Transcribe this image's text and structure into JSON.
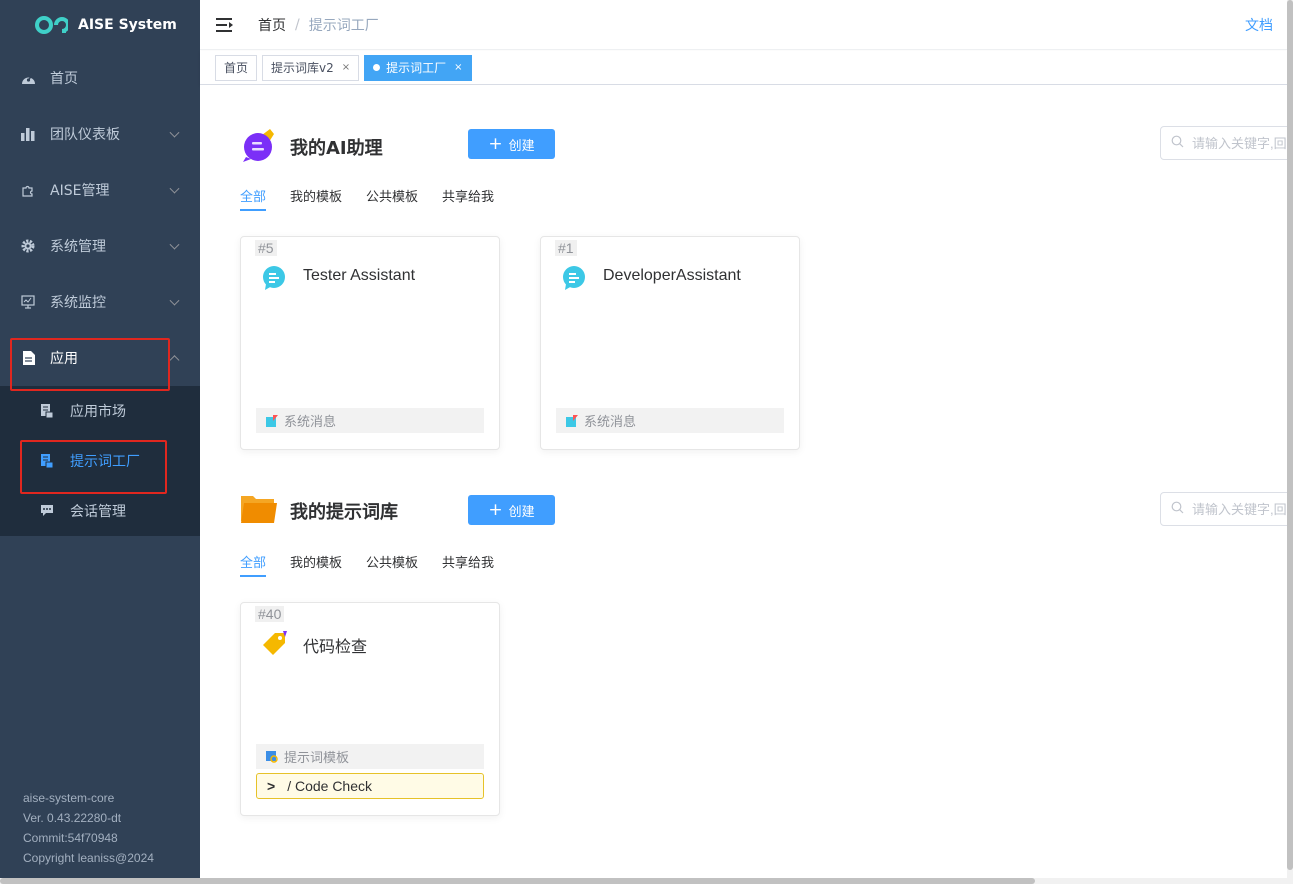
{
  "app": {
    "name": "AISE System"
  },
  "sidebar": {
    "items": [
      {
        "label": "首页",
        "icon": "dashboard-icon"
      },
      {
        "label": "团队仪表板",
        "icon": "bar-chart-icon"
      },
      {
        "label": "AISE管理",
        "icon": "puzzle-icon"
      },
      {
        "label": "系统管理",
        "icon": "gear-icon"
      },
      {
        "label": "系统监控",
        "icon": "monitor-icon"
      },
      {
        "label": "应用",
        "icon": "document-icon"
      }
    ],
    "sub_items": [
      {
        "label": "应用市场",
        "icon": "app-market-icon"
      },
      {
        "label": "提示词工厂",
        "icon": "prompt-factory-icon"
      },
      {
        "label": "会话管理",
        "icon": "chat-icon"
      }
    ],
    "version": {
      "module": "aise-system-core",
      "ver": "Ver. 0.43.22280-dt",
      "commit": "Commit:54f70948",
      "copyright": "Copyright leaniss@2024"
    }
  },
  "header": {
    "breadcrumb_home": "首页",
    "breadcrumb_sep": "/",
    "breadcrumb_current": "提示词工厂",
    "doc_link": "文档"
  },
  "tags": [
    {
      "label": "首页"
    },
    {
      "label": "提示词库v2",
      "close": "×"
    },
    {
      "label": "提示词工厂",
      "close": "×"
    }
  ],
  "assistant_section": {
    "title": "我的AI助理",
    "create_label": "创建",
    "search_placeholder": "请输入关键字,回车搜索",
    "tabs": [
      "全部",
      "我的模板",
      "公共模板",
      "共享给我"
    ],
    "cards": [
      {
        "id": "#5",
        "title": "Tester Assistant",
        "footer": "系统消息"
      },
      {
        "id": "#1",
        "title": "DeveloperAssistant",
        "footer": "系统消息"
      }
    ]
  },
  "prompt_section": {
    "title": "我的提示词库",
    "create_label": "创建",
    "search_placeholder": "请输入关键字,回车搜索",
    "tabs": [
      "全部",
      "我的模板",
      "公共模板",
      "共享给我"
    ],
    "cards": [
      {
        "id": "#40",
        "title": "代码检查",
        "footer": "提示词模板",
        "command_prefix": ">",
        "command": "/ Code Check"
      }
    ]
  },
  "colors": {
    "sidebar_bg": "#304156",
    "submenu_bg": "#1f2d3d",
    "accent": "#409eff",
    "highlight_box": "#e0271f"
  }
}
